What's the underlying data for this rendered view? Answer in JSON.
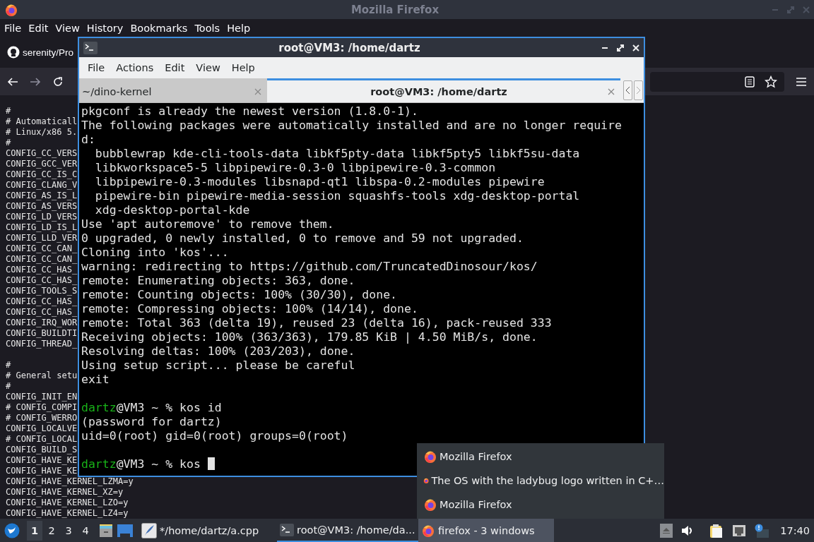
{
  "browser": {
    "title": "Mozilla Firefox",
    "menu": [
      "File",
      "Edit",
      "View",
      "History",
      "Bookmarks",
      "Tools",
      "Help"
    ],
    "tab": {
      "title": "serenity/Pro"
    },
    "source_blocks": [
      [
        "#",
        "# Automaticall",
        "# Linux/x86 5.",
        "#",
        "CONFIG_CC_VERS",
        "CONFIG_GCC_VER",
        "CONFIG_CC_IS_C",
        "CONFIG_CLANG_V",
        "CONFIG_AS_IS_L",
        "CONFIG_AS_VERS",
        "CONFIG_LD_VERS",
        "CONFIG_LD_IS_L",
        "CONFIG_LLD_VER",
        "CONFIG_CC_CAN_",
        "CONFIG_CC_CAN_",
        "CONFIG_CC_HAS_",
        "CONFIG_CC_HAS_",
        "CONFIG_TOOLS_S",
        "CONFIG_CC_HAS_",
        "CONFIG_CC_HAS_",
        "CONFIG_IRQ_WOR",
        "CONFIG_BUILDTI",
        "CONFIG_THREAD_"
      ],
      [
        "#",
        "# General setu",
        "#",
        "CONFIG_INIT_EN",
        "# CONFIG_COMPI",
        "# CONFIG_WERRO",
        "CONFIG_LOCALVE",
        "# CONFIG_LOCAL",
        "CONFIG_BUILD_S",
        "CONFIG_HAVE_KE",
        "CONFIG_HAVE_KE",
        "CONFIG_HAVE_KERNEL_LZMA=y",
        "CONFIG_HAVE_KERNEL_XZ=y",
        "CONFIG_HAVE_KERNEL_LZO=y",
        "CONFIG_HAVE_KERNEL_LZ4=y"
      ]
    ]
  },
  "terminal": {
    "title": "root@VM3: /home/dartz",
    "menu": [
      "File",
      "Actions",
      "Edit",
      "View",
      "Help"
    ],
    "tabs": [
      {
        "label": "~/dino-kernel",
        "selected": false
      },
      {
        "label": "root@VM3: /home/dartz",
        "selected": true
      }
    ],
    "lines": [
      {
        "kind": "output",
        "text": "pkgconf is already the newest version (1.8.0-1)."
      },
      {
        "kind": "output",
        "text": "The following packages were automatically installed and are no longer require"
      },
      {
        "kind": "output",
        "text": "d:"
      },
      {
        "kind": "output",
        "text": "  bubblewrap kde-cli-tools-data libkf5pty-data libkf5pty5 libkf5su-data"
      },
      {
        "kind": "output",
        "text": "  libkworkspace5-5 libpipewire-0.3-0 libpipewire-0.3-common"
      },
      {
        "kind": "output",
        "text": "  libpipewire-0.3-modules libsnapd-qt1 libspa-0.2-modules pipewire"
      },
      {
        "kind": "output",
        "text": "  pipewire-bin pipewire-media-session squashfs-tools xdg-desktop-portal"
      },
      {
        "kind": "output",
        "text": "  xdg-desktop-portal-kde"
      },
      {
        "kind": "output",
        "text": "Use 'apt autoremove' to remove them."
      },
      {
        "kind": "output",
        "text": "0 upgraded, 0 newly installed, 0 to remove and 59 not upgraded."
      },
      {
        "kind": "output",
        "text": "Cloning into 'kos'..."
      },
      {
        "kind": "output",
        "text": "warning: redirecting to https://github.com/TruncatedDinosour/kos/"
      },
      {
        "kind": "output",
        "text": "remote: Enumerating objects: 363, done."
      },
      {
        "kind": "output",
        "text": "remote: Counting objects: 100% (30/30), done."
      },
      {
        "kind": "output",
        "text": "remote: Compressing objects: 100% (14/14), done."
      },
      {
        "kind": "output",
        "text": "remote: Total 363 (delta 19), reused 23 (delta 16), pack-reused 333"
      },
      {
        "kind": "output",
        "text": "Receiving objects: 100% (363/363), 179.85 KiB | 4.50 MiB/s, done."
      },
      {
        "kind": "output",
        "text": "Resolving deltas: 100% (203/203), done."
      },
      {
        "kind": "output",
        "text": "Using setup script... please be careful"
      },
      {
        "kind": "output",
        "text": "exit"
      },
      {
        "kind": "blank"
      },
      {
        "kind": "prompt",
        "user": "dartz",
        "rest": "@VM3 ~ % kos id",
        "cursor": false
      },
      {
        "kind": "output",
        "text": "(password for dartz)"
      },
      {
        "kind": "output",
        "text": "uid=0(root) gid=0(root) groups=0(root)"
      },
      {
        "kind": "blank"
      },
      {
        "kind": "prompt",
        "user": "dartz",
        "rest": "@VM3 ~ % kos",
        "cursor": true
      }
    ]
  },
  "window_list": {
    "items": [
      "Mozilla Firefox",
      "The OS with the ladybug logo written in C+…",
      "Mozilla Firefox"
    ]
  },
  "taskbar": {
    "workspaces": [
      {
        "label": "1",
        "selected": true
      },
      {
        "label": "2",
        "selected": false
      },
      {
        "label": "3",
        "selected": false
      },
      {
        "label": "4",
        "selected": false
      }
    ],
    "tasks": [
      {
        "kind": "editor",
        "label": "*/home/dartz/a.cpp",
        "selected": false
      },
      {
        "kind": "terminal",
        "label": "root@VM3: /home/da...",
        "selected": false
      },
      {
        "kind": "firefox",
        "label": "firefox - 3 windows",
        "selected": true
      }
    ],
    "clock": "17:40"
  }
}
